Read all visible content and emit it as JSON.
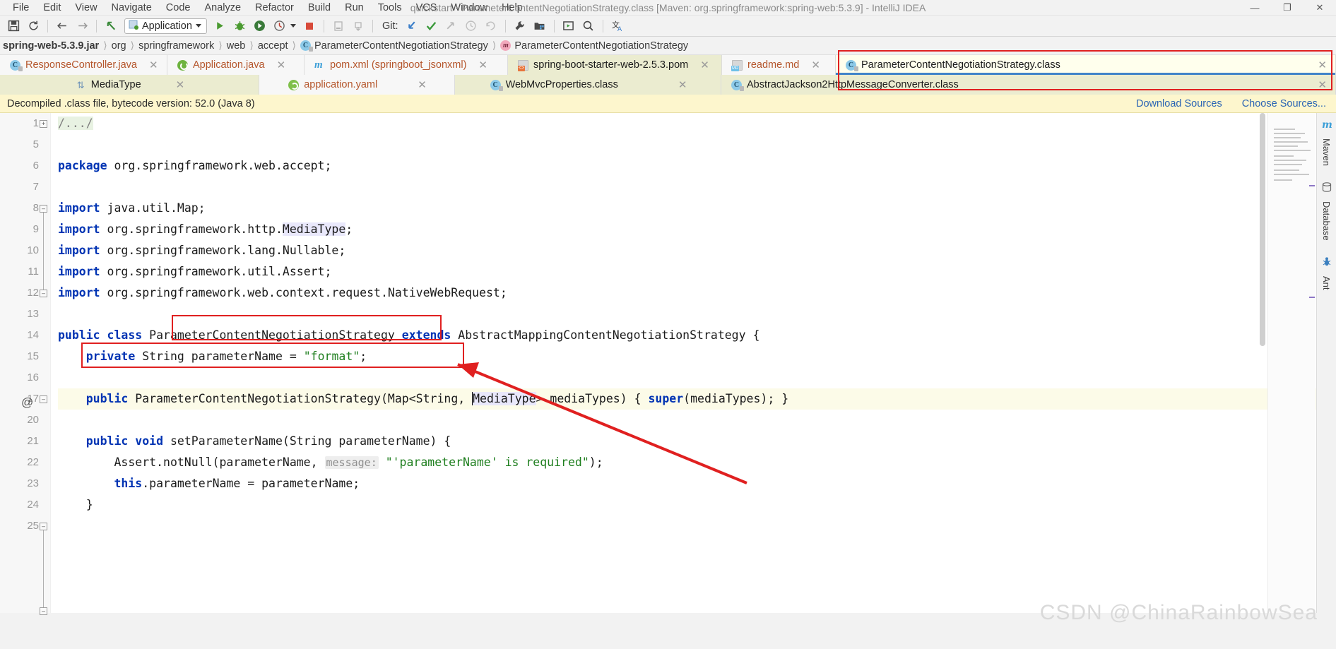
{
  "window": {
    "title": "quickstart - ParameterContentNegotiationStrategy.class [Maven: org.springframework:spring-web:5.3.9] - IntelliJ IDEA",
    "minimize": "—",
    "maximize": "❐",
    "close": "✕"
  },
  "menu": [
    {
      "label": "File"
    },
    {
      "label": "Edit"
    },
    {
      "label": "View"
    },
    {
      "label": "Navigate"
    },
    {
      "label": "Code"
    },
    {
      "label": "Analyze"
    },
    {
      "label": "Refactor"
    },
    {
      "label": "Build"
    },
    {
      "label": "Run"
    },
    {
      "label": "Tools"
    },
    {
      "label": "VCS"
    },
    {
      "label": "Window"
    },
    {
      "label": "Help"
    }
  ],
  "toolbar": {
    "save_icon": "save-icon",
    "sync_icon": "sync-icon",
    "back_icon": "back-arrow-icon",
    "forward_icon": "forward-arrow-icon",
    "up_icon": "up-arrow-icon",
    "run_config": "Application",
    "run_icon": "run-icon",
    "debug_icon": "debug-icon",
    "coverage_icon": "run-with-coverage-icon",
    "profile_icon": "profiler-icon",
    "stop_icon": "stop-icon",
    "device_icon": "device-manager-icon",
    "sync_gradle_icon": "sync-project-icon",
    "git_label": "Git:",
    "update_icon": "git-update-icon",
    "commit_icon": "git-commit-icon",
    "push_icon": "git-push-icon",
    "history_icon": "git-history-icon",
    "rollback_icon": "git-rollback-icon",
    "settings_icon": "wrench-icon",
    "project_structure_icon": "project-structure-icon",
    "run_anything_icon": "run-anything-icon",
    "search_icon": "search-everywhere-icon",
    "translate_icon": "translate-icon"
  },
  "breadcrumb": [
    {
      "label": "spring-web-5.3.9.jar",
      "icon": "none"
    },
    {
      "label": "org",
      "icon": "none"
    },
    {
      "label": "springframework",
      "icon": "none"
    },
    {
      "label": "web",
      "icon": "none"
    },
    {
      "label": "accept",
      "icon": "none"
    },
    {
      "label": "ParameterContentNegotiationStrategy",
      "icon": "class-icon"
    },
    {
      "label": "ParameterContentNegotiationStrategy",
      "icon": "method-icon"
    }
  ],
  "tabs_row1": [
    {
      "label": "ResponseController.java",
      "icon": "class-icon",
      "state": "white",
      "close": "✕"
    },
    {
      "label": "Application.java",
      "icon": "springboot-icon",
      "state": "white",
      "close": "✕"
    },
    {
      "label": "pom.xml (springboot_jsonxml)",
      "icon": "maven-icon",
      "state": "white",
      "close": "✕"
    },
    {
      "label": "spring-boot-starter-web-2.5.3.pom",
      "icon": "pom-icon",
      "state": "yellow",
      "close": "✕"
    },
    {
      "label": "readme.md",
      "icon": "markdown-icon",
      "state": "white",
      "close": "✕"
    },
    {
      "label": "ParameterContentNegotiationStrategy.class",
      "icon": "class-icon",
      "state": "active",
      "close": "✕"
    }
  ],
  "tabs_row2": [
    {
      "label": "MediaType",
      "icon": "mediatype-icon",
      "state": "yellow",
      "close": "✕"
    },
    {
      "label": "application.yaml",
      "icon": "yaml-icon",
      "state": "white",
      "close": "✕"
    },
    {
      "label": "WebMvcProperties.class",
      "icon": "class-icon",
      "state": "yellow",
      "close": "✕"
    },
    {
      "label": "AbstractJackson2HttpMessageConverter.class",
      "icon": "class-icon",
      "state": "yellow",
      "close": "✕"
    }
  ],
  "notice": {
    "text": "Decompiled .class file, bytecode version: 52.0 (Java 8)",
    "download_sources": "Download Sources",
    "choose_sources": "Choose Sources..."
  },
  "editor": {
    "line_numbers": [
      "1",
      "5",
      "6",
      "7",
      "8",
      "9",
      "10",
      "11",
      "12",
      "13",
      "14",
      "15",
      "16",
      "17",
      "20",
      "21",
      "22",
      "23",
      "24",
      "25"
    ],
    "lines": [
      {
        "num": "1",
        "text": "/.../"
      },
      {
        "num": "5",
        "text": ""
      },
      {
        "num": "6",
        "text": "package org.springframework.web.accept;"
      },
      {
        "num": "7",
        "text": ""
      },
      {
        "num": "8",
        "text": "import java.util.Map;"
      },
      {
        "num": "9",
        "text": "import org.springframework.http.MediaType;"
      },
      {
        "num": "10",
        "text": "import org.springframework.lang.Nullable;"
      },
      {
        "num": "11",
        "text": "import org.springframework.util.Assert;"
      },
      {
        "num": "12",
        "text": "import org.springframework.web.context.request.NativeWebRequest;"
      },
      {
        "num": "13",
        "text": ""
      },
      {
        "num": "14",
        "text": "public class ParameterContentNegotiationStrategy extends AbstractMappingContentNegotiationStrategy {"
      },
      {
        "num": "15",
        "text": "    private String parameterName = \"format\";"
      },
      {
        "num": "16",
        "text": ""
      },
      {
        "num": "17",
        "text": "    public ParameterContentNegotiationStrategy(Map<String, MediaType> mediaTypes) { super(mediaTypes); }"
      },
      {
        "num": "20",
        "text": ""
      },
      {
        "num": "21",
        "text": "    public void setParameterName(String parameterName) {"
      },
      {
        "num": "22",
        "text": "        Assert.notNull(parameterName,  message: \"'parameterName' is required\");"
      },
      {
        "num": "23",
        "text": "        this.parameterName = parameterName;"
      },
      {
        "num": "24",
        "text": "    }"
      },
      {
        "num": "25",
        "text": ""
      }
    ],
    "override_marker": "@",
    "bulb_icon": "intention-bulb-icon",
    "param_hint_22": "message:"
  },
  "right_tool_windows": [
    {
      "label": "Maven",
      "icon": "maven-tool-icon"
    },
    {
      "label": "Database",
      "icon": "database-tool-icon"
    },
    {
      "label": "Ant",
      "icon": "ant-tool-icon"
    }
  ],
  "watermark": "CSDN @ChinaRainbowSea",
  "colors": {
    "accent_blue": "#4083c9",
    "annotation_red": "#e02020",
    "tab_yellow": "#ebecd0",
    "active_tab": "#ffffed",
    "notice_yellow": "#fdf6cd",
    "keyword_blue": "#0033b3",
    "string_green": "#1f7f1f"
  }
}
